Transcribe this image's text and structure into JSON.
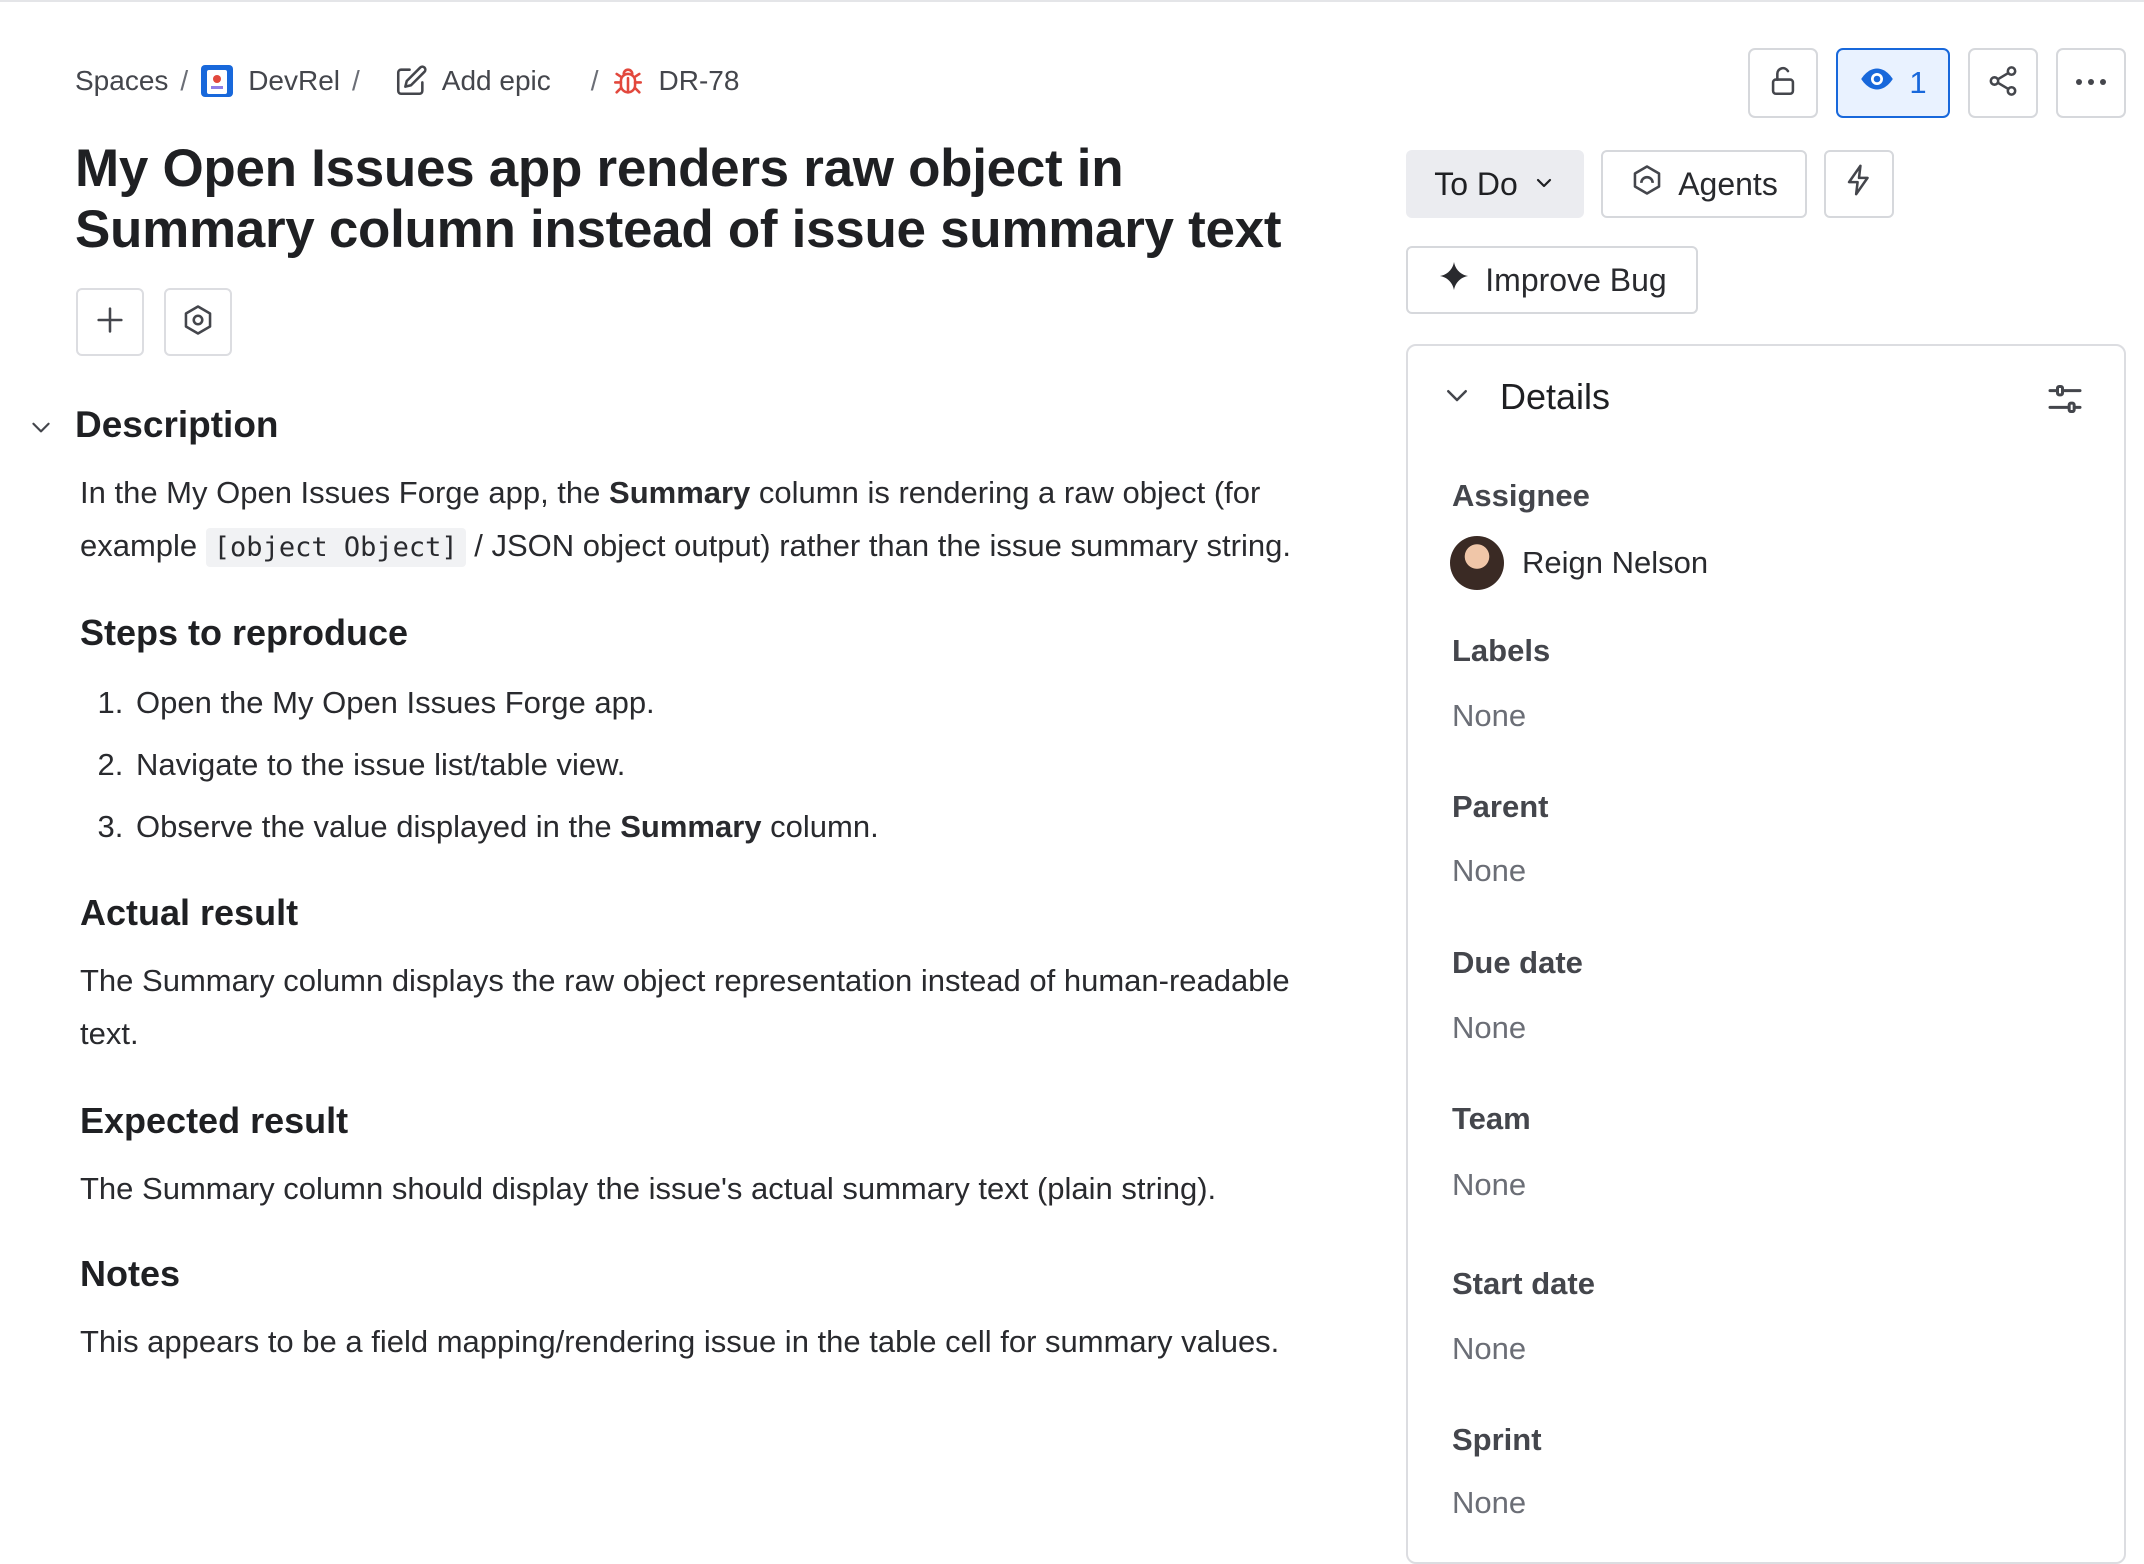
{
  "breadcrumbs": {
    "spaces": "Spaces",
    "project": "DevRel",
    "add_epic": "Add epic",
    "issue_key": "DR-78",
    "separator": "/"
  },
  "issue": {
    "title": "My Open Issues app renders raw object in Summary column instead of issue summary text"
  },
  "header_actions": {
    "watchers_count": "1",
    "icons": [
      "lock-icon",
      "eye-icon",
      "share-icon",
      "more-icon"
    ]
  },
  "status": {
    "label": "To Do"
  },
  "actions": {
    "agents_label": "Agents",
    "improve_label": "Improve Bug"
  },
  "description": {
    "heading": "Description",
    "intro_a": "In the My Open Issues Forge app, the ",
    "intro_bold": "Summary",
    "intro_b": " column is rendering a raw object (for example ",
    "intro_code": "[object Object]",
    "intro_c": " / JSON object output) rather than the issue summary string.",
    "steps_heading": "Steps to reproduce",
    "step1": "Open the My Open Issues Forge app.",
    "step2": "Navigate to the issue list/table view.",
    "step3_a": "Observe the value displayed in the ",
    "step3_bold": "Summary",
    "step3_b": " column.",
    "actual_heading": "Actual result",
    "actual_text": "The Summary column displays the raw object representation instead of human-readable text.",
    "expected_heading": "Expected result",
    "expected_text": "The Summary column should display the issue's actual summary text (plain string).",
    "notes_heading": "Notes",
    "notes_text": "This appears to be a field mapping/rendering issue in the table cell for summary values."
  },
  "details": {
    "heading": "Details",
    "assignee_label": "Assignee",
    "assignee_name": "Reign Nelson",
    "labels_label": "Labels",
    "labels_value": "None",
    "parent_label": "Parent",
    "parent_value": "None",
    "due_label": "Due date",
    "due_value": "None",
    "team_label": "Team",
    "team_value": "None",
    "start_label": "Start date",
    "start_value": "None",
    "sprint_label": "Sprint",
    "sprint_value": "None"
  },
  "colors": {
    "accent": "#1868db",
    "bug": "#e2483d"
  }
}
